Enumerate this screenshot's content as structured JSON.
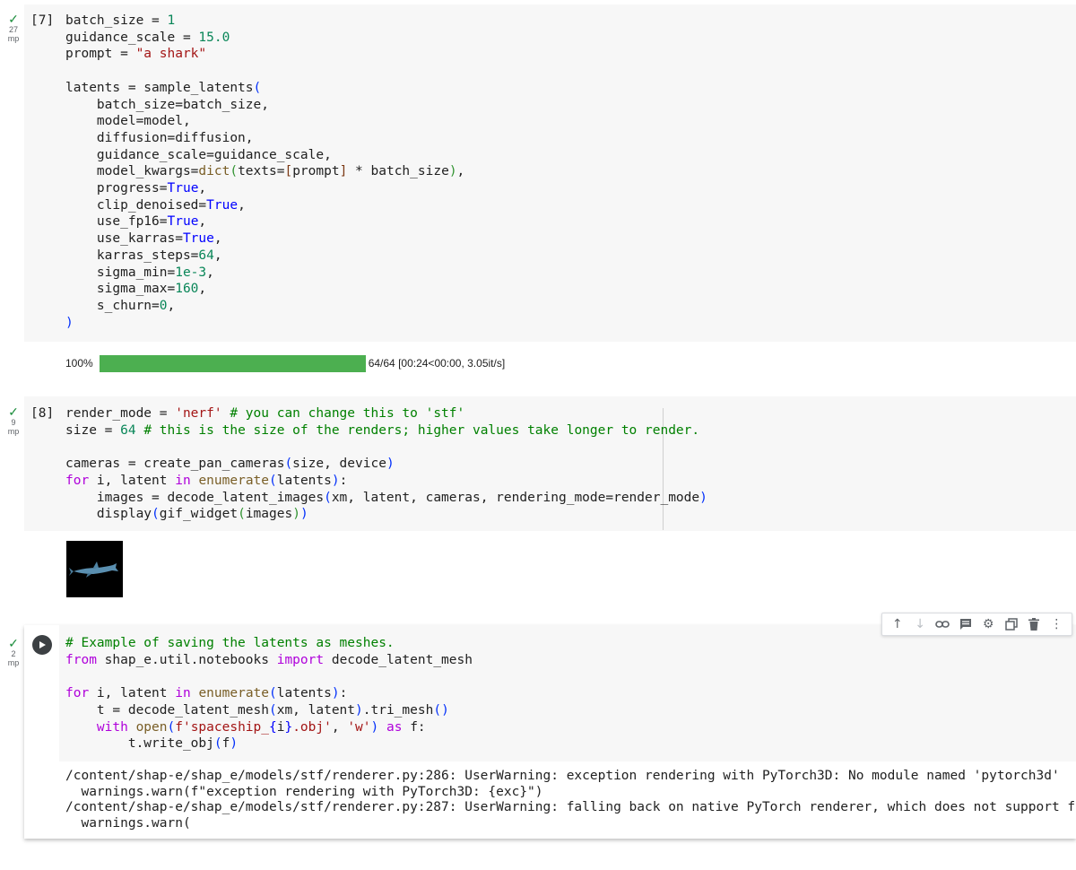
{
  "cells": [
    {
      "prompt": "[7]",
      "status": {
        "check": "✓",
        "count": "27",
        "unit": "mp"
      },
      "output": {
        "percent": "100%",
        "progress": 1.0,
        "stats": "64/64 [00:24<00:00, 3.05it/s]"
      }
    },
    {
      "prompt": "[8]",
      "status": {
        "check": "✓",
        "count": "9",
        "unit": "mp"
      },
      "output": {
        "image": "shark-render"
      }
    },
    {
      "status": {
        "check": "✓",
        "count": "2",
        "unit": "mp"
      },
      "output": {
        "lines": [
          "/content/shap-e/shap_e/models/stf/renderer.py:286: UserWarning: exception rendering with PyTorch3D: No module named 'pytorch3d'",
          "  warnings.warn(f\"exception rendering with PyTorch3D: {exc}\")",
          "/content/shap-e/shap_e/models/stf/renderer.py:287: UserWarning: falling back on native PyTorch renderer, which does not support full gra",
          "  warnings.warn("
        ]
      }
    }
  ],
  "toolbar": {
    "icons": [
      "arrow-up-icon",
      "arrow-down-icon",
      "link-icon",
      "comment-icon",
      "gear-icon",
      "mirror-cell-icon",
      "trash-icon",
      "more-vert-icon"
    ]
  },
  "colors": {
    "progress": "#4caf50",
    "check": "#1e8e3e"
  }
}
